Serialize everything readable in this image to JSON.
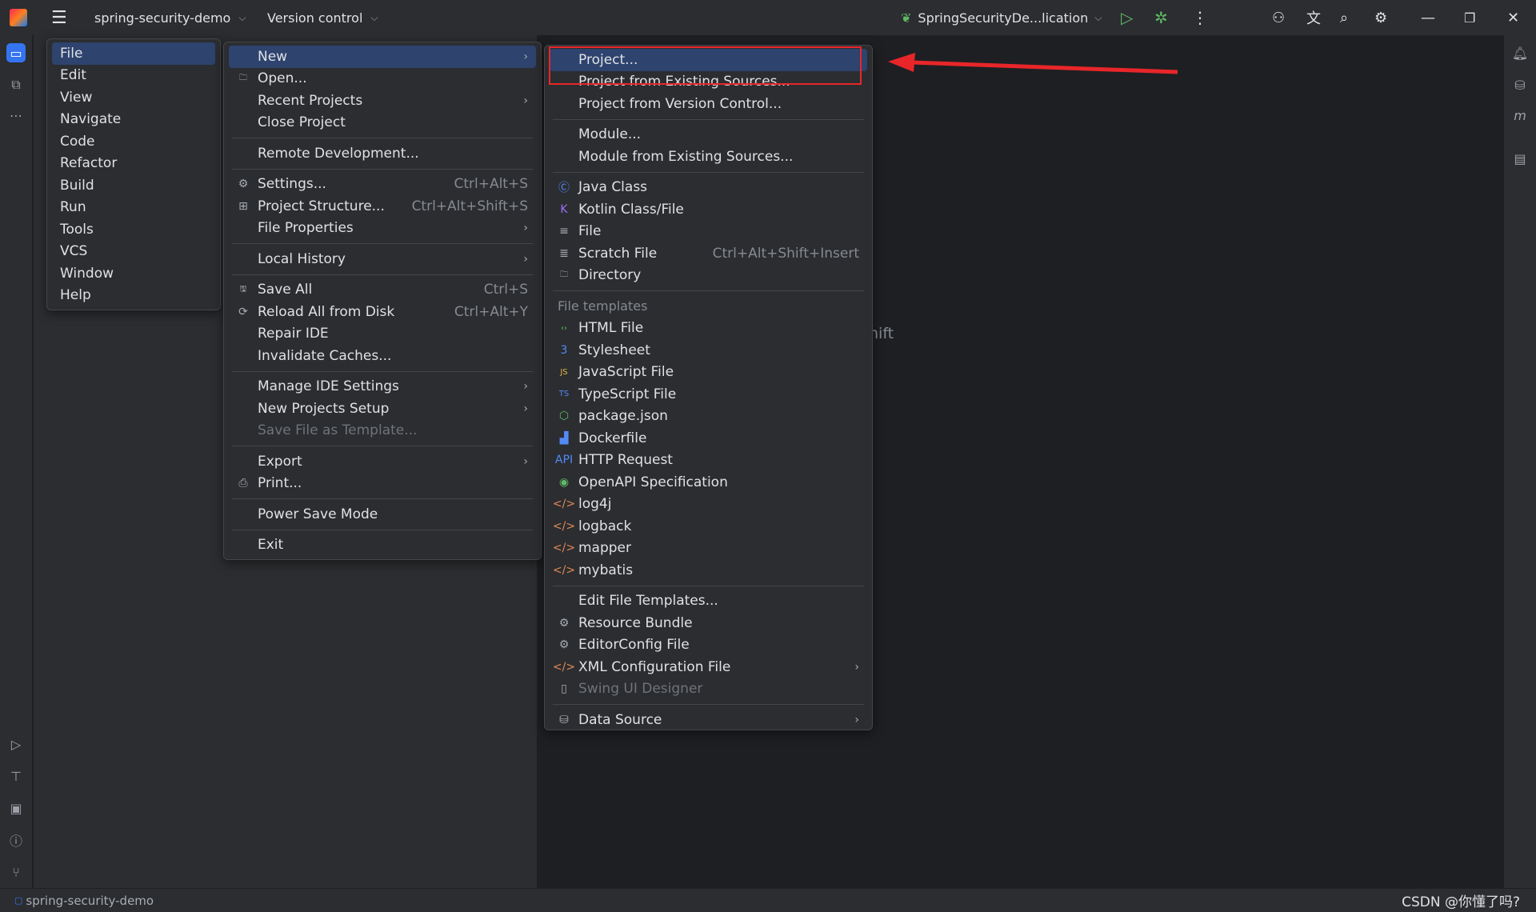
{
  "titlebar": {
    "project": "spring-security-demo",
    "vcs": "Version control",
    "run_config": "SpringSecurityDe...lication"
  },
  "main_menu": [
    {
      "label": "File",
      "selected": true
    },
    {
      "label": "Edit"
    },
    {
      "label": "View"
    },
    {
      "label": "Navigate"
    },
    {
      "label": "Code"
    },
    {
      "label": "Refactor"
    },
    {
      "label": "Build"
    },
    {
      "label": "Run"
    },
    {
      "label": "Tools"
    },
    {
      "label": "VCS"
    },
    {
      "label": "Window"
    },
    {
      "label": "Help"
    }
  ],
  "file_menu": [
    {
      "label": "New",
      "arrow": true,
      "selected": true
    },
    {
      "label": "Open...",
      "icon": "folder-icon"
    },
    {
      "label": "Recent Projects",
      "arrow": true
    },
    {
      "label": "Close Project"
    },
    {
      "sep": true
    },
    {
      "label": "Remote Development..."
    },
    {
      "sep": true
    },
    {
      "label": "Settings...",
      "shortcut": "Ctrl+Alt+S",
      "icon": "gear-icon"
    },
    {
      "label": "Project Structure...",
      "shortcut": "Ctrl+Alt+Shift+S",
      "icon": "project-structure-icon"
    },
    {
      "label": "File Properties",
      "arrow": true
    },
    {
      "sep": true
    },
    {
      "label": "Local History",
      "arrow": true
    },
    {
      "sep": true
    },
    {
      "label": "Save All",
      "shortcut": "Ctrl+S",
      "icon": "save-icon"
    },
    {
      "label": "Reload All from Disk",
      "shortcut": "Ctrl+Alt+Y",
      "icon": "reload-icon"
    },
    {
      "label": "Repair IDE"
    },
    {
      "label": "Invalidate Caches..."
    },
    {
      "sep": true
    },
    {
      "label": "Manage IDE Settings",
      "arrow": true
    },
    {
      "label": "New Projects Setup",
      "arrow": true
    },
    {
      "label": "Save File as Template...",
      "disabled": true
    },
    {
      "sep": true
    },
    {
      "label": "Export",
      "arrow": true
    },
    {
      "label": "Print...",
      "icon": "print-icon"
    },
    {
      "sep": true
    },
    {
      "label": "Power Save Mode"
    },
    {
      "sep": true
    },
    {
      "label": "Exit"
    }
  ],
  "new_menu": [
    {
      "label": "Project...",
      "selected": true
    },
    {
      "label": "Project from Existing Sources..."
    },
    {
      "label": "Project from Version Control..."
    },
    {
      "sep": true
    },
    {
      "label": "Module..."
    },
    {
      "label": "Module from Existing Sources..."
    },
    {
      "sep": true
    },
    {
      "label": "Java Class",
      "icon": "java-class-icon"
    },
    {
      "label": "Kotlin Class/File",
      "icon": "kotlin-icon"
    },
    {
      "label": "File",
      "icon": "file-icon"
    },
    {
      "label": "Scratch File",
      "shortcut": "Ctrl+Alt+Shift+Insert",
      "icon": "scratch-file-icon"
    },
    {
      "label": "Directory",
      "icon": "folder-icon"
    },
    {
      "sep": true
    },
    {
      "header": "File templates"
    },
    {
      "label": "HTML File",
      "icon": "html-icon"
    },
    {
      "label": "Stylesheet",
      "icon": "css-icon"
    },
    {
      "label": "JavaScript File",
      "icon": "javascript-icon"
    },
    {
      "label": "TypeScript File",
      "icon": "typescript-icon"
    },
    {
      "label": "package.json",
      "icon": "nodejs-icon"
    },
    {
      "label": "Dockerfile",
      "icon": "docker-icon"
    },
    {
      "label": "HTTP Request",
      "icon": "api-icon"
    },
    {
      "label": "OpenAPI Specification",
      "icon": "openapi-icon"
    },
    {
      "label": "log4j",
      "icon": "xml-icon"
    },
    {
      "label": "logback",
      "icon": "xml-icon"
    },
    {
      "label": "mapper",
      "icon": "xml-icon"
    },
    {
      "label": "mybatis",
      "icon": "xml-icon"
    },
    {
      "sep": true
    },
    {
      "label": "Edit File Templates..."
    },
    {
      "label": "Resource Bundle",
      "icon": "gear-icon"
    },
    {
      "label": "EditorConfig File",
      "icon": "gear-icon"
    },
    {
      "label": "XML Configuration File",
      "icon": "xml-icon",
      "arrow": true
    },
    {
      "label": "Swing UI Designer",
      "icon": "swing-icon",
      "disabled": true
    },
    {
      "sep": true
    },
    {
      "label": "Data Source",
      "icon": "database-icon",
      "arrow": true
    }
  ],
  "editor_hint": "nift",
  "statusbar": {
    "project": "spring-security-demo",
    "watermark": "CSDN @你懂了吗?"
  },
  "colors": {
    "highlight": "#2e436e",
    "annotation": "#e8262a",
    "background": "#1e1f22"
  }
}
